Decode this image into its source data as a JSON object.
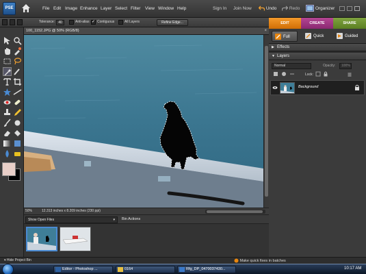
{
  "app": {
    "logo_text": "PSE",
    "menu": [
      "File",
      "Edit",
      "Image",
      "Enhance",
      "Layer",
      "Select",
      "Filter",
      "View",
      "Window",
      "Help"
    ],
    "sign_in": "Sign In",
    "join_now": "Join Now",
    "undo": "Undo",
    "redo": "Redo",
    "organizer": "Organizer"
  },
  "options_bar": {
    "tolerance_label": "Tolerance:",
    "tolerance_value": "40",
    "anti_alias": "Anti-alias",
    "contiguous": "Contiguous",
    "all_layers": "All Layers",
    "refine_edge": "Refine Edge..."
  },
  "mode_tabs": {
    "edit": "EDIT",
    "create": "CREATE",
    "share": "SHARE",
    "colors": {
      "edit": "#e8860f",
      "create": "#a3347f",
      "share": "#6e952d"
    }
  },
  "sub_tabs": {
    "full": "Full",
    "quick": "Quick",
    "guided": "Guided"
  },
  "document": {
    "title": "100_1152.JPG @ 50% (RGB/8)",
    "zoom": "50%",
    "dimensions": "12.313 inches x 8.209 inches (230 ppi)"
  },
  "project_bin": {
    "dropdown": "Show Open Files",
    "bin_actions": "Bin Actions",
    "hide_bin": "Hide Project Bin"
  },
  "panels": {
    "effects": "Effects",
    "layers": "Layers",
    "blend_mode": "Normal",
    "opacity_label": "Opacity:",
    "opacity_value": "100%",
    "lock_label": "Lock:",
    "layer_name": "Background"
  },
  "tip": "Make quick fixes in batches",
  "taskbar": {
    "items": [
      "Editor - Photoshop ...",
      "0164",
      "Rfg_DP_0470037430..."
    ],
    "clock": "10:17 AM"
  },
  "colors": {
    "foreground": "#e9cfc8",
    "background": "#000000",
    "accent_selection": "#4a8ad2"
  }
}
